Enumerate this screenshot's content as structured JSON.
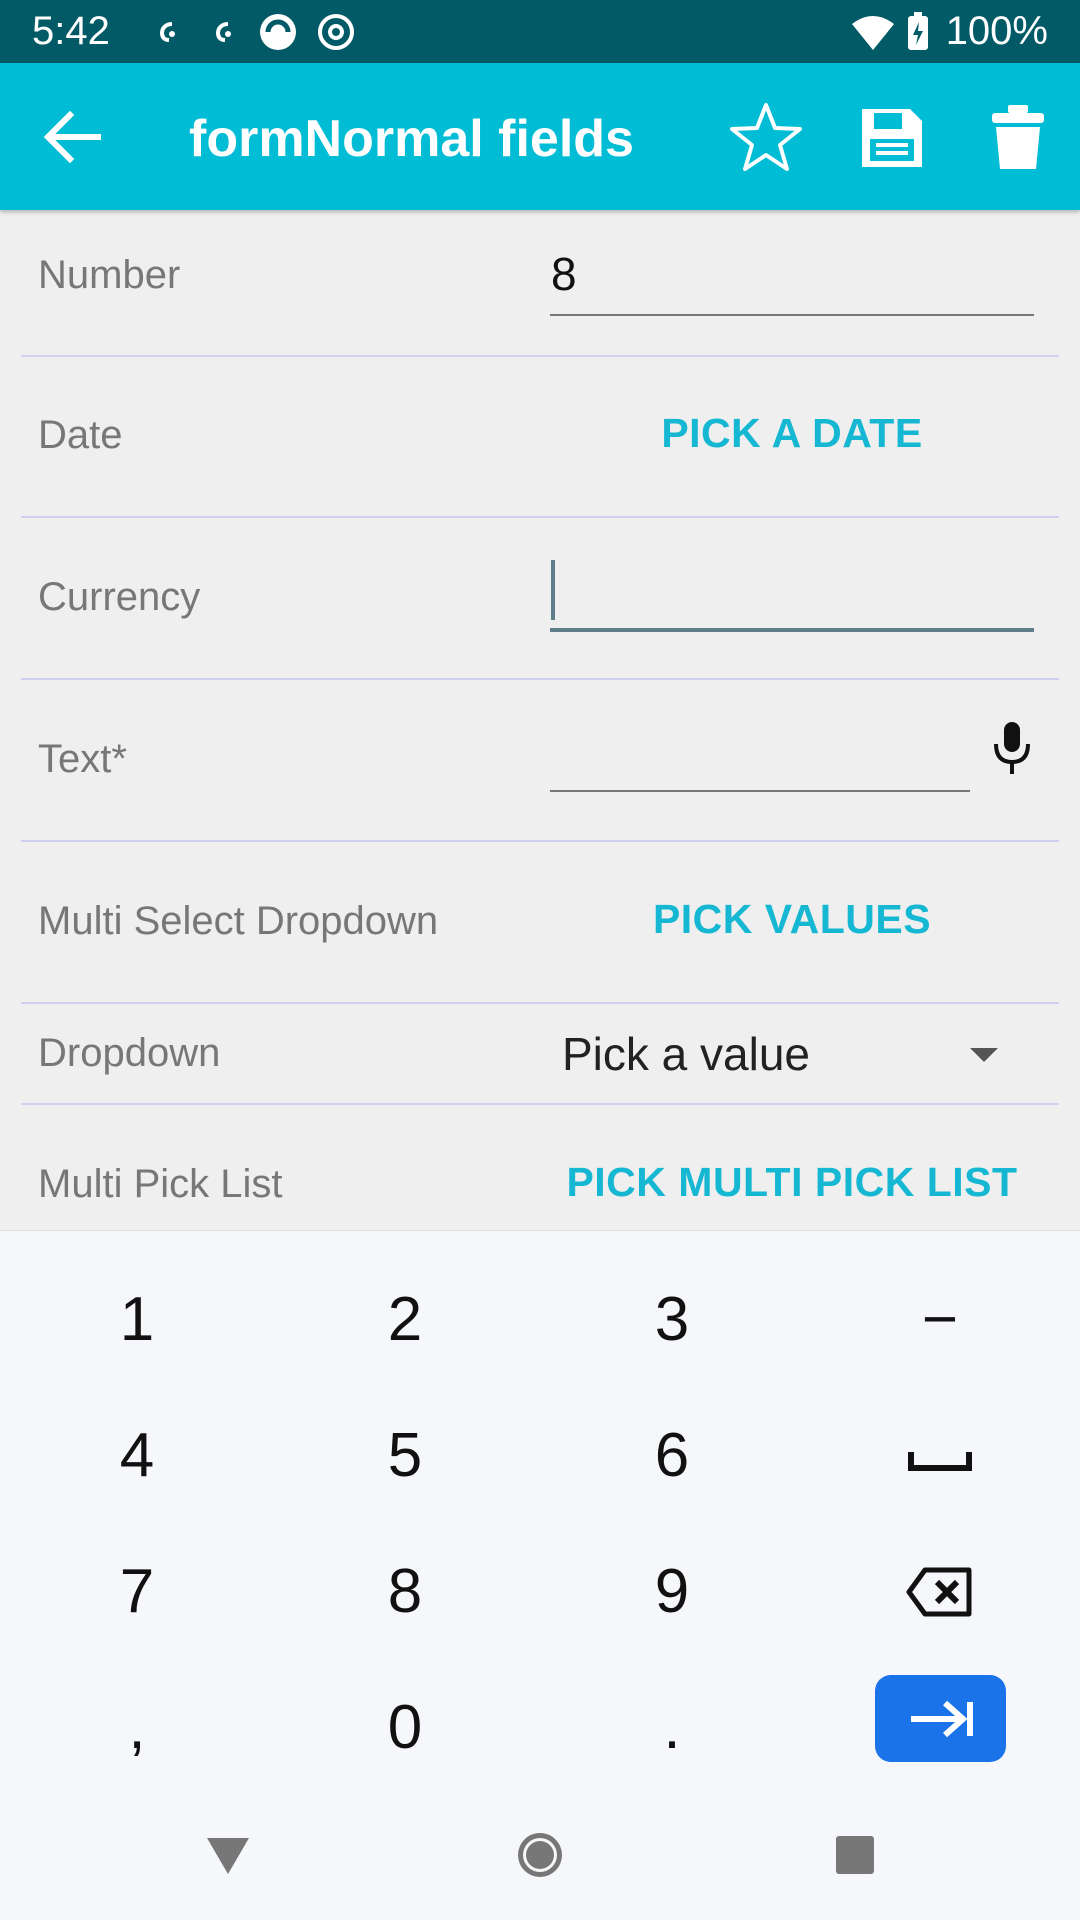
{
  "status_bar": {
    "time": "5:42",
    "battery_text": "100%",
    "background_color": "#015a66"
  },
  "app_bar": {
    "title": "formNormal fields",
    "background_color": "#00bcd4",
    "icons": [
      "back-arrow-icon",
      "star-outline-icon",
      "save-icon",
      "trash-icon"
    ]
  },
  "form": {
    "number": {
      "label": "Number",
      "value": "8"
    },
    "date": {
      "label": "Date",
      "button": "PICK A DATE"
    },
    "currency": {
      "label": "Currency",
      "value": ""
    },
    "text": {
      "label": "Text*",
      "value": ""
    },
    "multi_select": {
      "label": "Multi Select Dropdown",
      "button": "PICK VALUES"
    },
    "dropdown": {
      "label": "Dropdown",
      "value": "Pick a value"
    },
    "multi_pick_list": {
      "label": "Multi Pick List",
      "button": "PICK MULTI PICK LIST"
    },
    "accent_color": "#15b7d2"
  },
  "keyboard": {
    "rows": [
      [
        "1",
        "2",
        "3",
        "−"
      ],
      [
        "4",
        "5",
        "6",
        "space"
      ],
      [
        "7",
        "8",
        "9",
        "backspace"
      ],
      [
        ",",
        "0",
        ".",
        "enter"
      ]
    ],
    "enter_color": "#1a73e8"
  }
}
